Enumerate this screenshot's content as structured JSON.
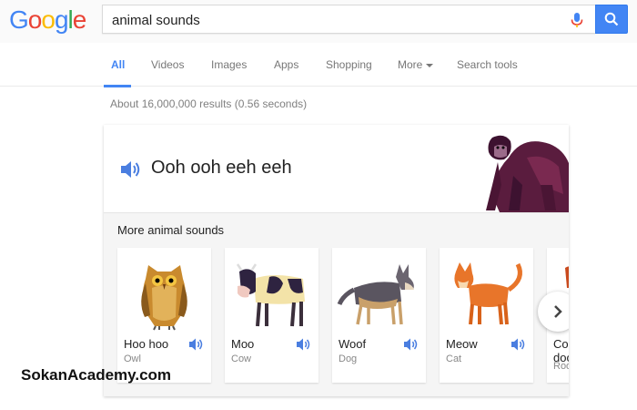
{
  "header": {
    "logo_letters": [
      {
        "char": "G",
        "color": "#4285f4"
      },
      {
        "char": "o",
        "color": "#ea4335"
      },
      {
        "char": "o",
        "color": "#fbbc05"
      },
      {
        "char": "g",
        "color": "#4285f4"
      },
      {
        "char": "l",
        "color": "#34a853"
      },
      {
        "char": "e",
        "color": "#ea4335"
      }
    ],
    "search_value": "animal sounds",
    "mic_icon": "microphone-icon",
    "search_icon": "search-icon"
  },
  "tabs": {
    "all": "All",
    "videos": "Videos",
    "images": "Images",
    "apps": "Apps",
    "shopping": "Shopping",
    "more": "More",
    "search_tools": "Search tools"
  },
  "results_stats": "About 16,000,000 results (0.56 seconds)",
  "card": {
    "sound_text": "Ooh ooh eeh eeh",
    "more_title": "More animal sounds",
    "animals": [
      {
        "sound": "Hoo hoo",
        "name": "Owl"
      },
      {
        "sound": "Moo",
        "name": "Cow"
      },
      {
        "sound": "Woof",
        "name": "Dog"
      },
      {
        "sound": "Meow",
        "name": "Cat"
      },
      {
        "sound": "Co",
        "sound2": "doo",
        "name": "Roo"
      }
    ]
  },
  "watermark": "SokanAcademy.com",
  "colors": {
    "accent": "#4285f4",
    "speaker": "#4a7ee0"
  }
}
